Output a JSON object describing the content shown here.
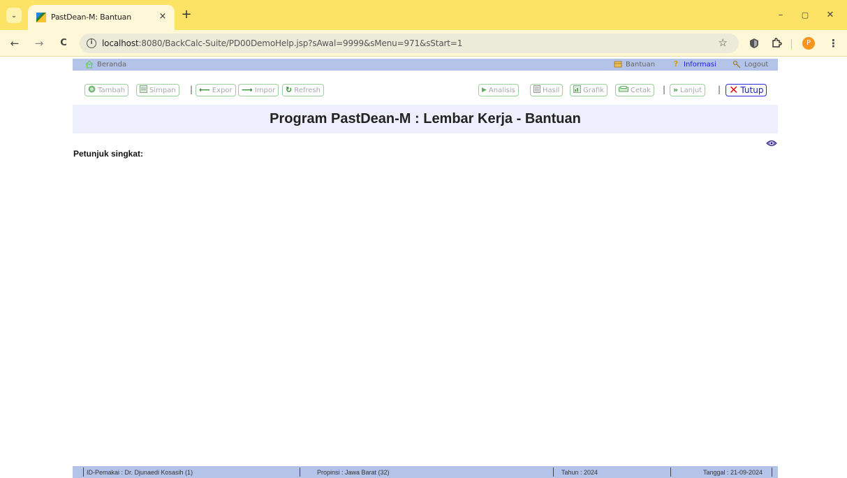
{
  "browser": {
    "tab": {
      "title": "PastDean-M: Bantuan",
      "close": "×"
    },
    "new_tab": "+",
    "window": {
      "minimize": "–",
      "restore": "▢",
      "close": "✕"
    },
    "nav": {
      "back": "←",
      "forward": "→",
      "reload": "C"
    },
    "url": {
      "host": "localhost",
      "rest": ":8080/BackCalc-Suite/PD00DemoHelp.jsp?sAwal=9999&sMenu=971&sStart=1"
    },
    "profile_initial": "P",
    "icons": [
      "info-icon",
      "star-icon",
      "extension-shield-icon",
      "puzzle-icon",
      "menu-icon"
    ]
  },
  "topnav": {
    "home": "Beranda",
    "help": "Bantuan",
    "info": "Informasi",
    "logout": "Logout"
  },
  "actions": {
    "tambah": "Tambah",
    "simpan": "Simpan",
    "expor": "Expor",
    "impor": "Impor",
    "refresh": "Refresh",
    "analisis": "Analisis",
    "hasil": "Hasil",
    "grafik": "Grafik",
    "cetak": "Cetak",
    "lanjut": "Lanjut",
    "tutup": "Tutup",
    "separator": "|"
  },
  "page": {
    "title": "Program PastDean-M : Lembar Kerja - Bantuan",
    "hint": "Petunjuk singkat:"
  },
  "status": {
    "user": "ID-Pemakai : Dr. Djunaedi Kosasih (1)",
    "province": "Propinsi : Jawa Barat (32)",
    "year": "Tahun : 2024",
    "date": "Tanggal : 21-09-2024"
  },
  "colors": {
    "tabbar": "#fde365",
    "navbar": "#b4c3e8",
    "title_bg": "#eeeffd",
    "button_border": "#9ccf9c",
    "active_border": "#2b2bd8",
    "close_x": "#e01010"
  }
}
